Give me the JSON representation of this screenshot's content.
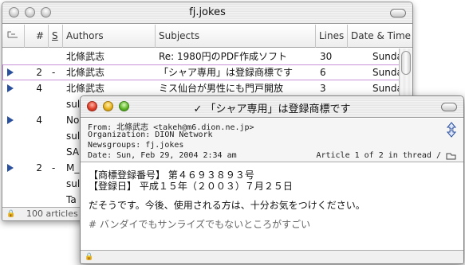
{
  "back_window": {
    "title": "fj.jokes",
    "columns": [
      "#",
      "S",
      "Authors",
      "Subjects",
      "Lines",
      "Date & Time"
    ],
    "rows": [
      {
        "num": "",
        "status": "",
        "author": "北條武志",
        "subject": "Re: 1980円のPDF作成ソフト",
        "lines": "30",
        "date": "Sunda",
        "triangle": false
      },
      {
        "num": "2",
        "status": "-",
        "author": "北條武志",
        "subject": "「シャア専用」は登録商標です",
        "lines": "6",
        "date": "Sunda",
        "triangle": true
      },
      {
        "num": "4",
        "status": "",
        "author": "北條武志",
        "subject": "ミス仙台が男性にも門戸開放",
        "lines": "3",
        "date": "Sunda",
        "triangle": true
      },
      {
        "num": "",
        "status": "",
        "author": "sul",
        "subject": "",
        "lines": "",
        "date": "",
        "triangle": false
      },
      {
        "num": "4",
        "status": "",
        "author": "No",
        "subject": "",
        "lines": "",
        "date": "",
        "triangle": true
      },
      {
        "num": "",
        "status": "",
        "author": "sul",
        "subject": "",
        "lines": "",
        "date": "",
        "triangle": false
      },
      {
        "num": "",
        "status": "",
        "author": "SA",
        "subject": "",
        "lines": "",
        "date": "",
        "triangle": false
      },
      {
        "num": "2",
        "status": "-",
        "author": "M_",
        "subject": "",
        "lines": "",
        "date": "",
        "triangle": true
      },
      {
        "num": "",
        "status": "",
        "author": "sul",
        "subject": "",
        "lines": "",
        "date": "",
        "triangle": false
      },
      {
        "num": "",
        "status": "",
        "author": "Ta",
        "subject": "",
        "lines": "",
        "date": "",
        "triangle": false
      }
    ],
    "status_text": "100 articles"
  },
  "front_window": {
    "title": "✓ 「シャア専用」は登録商標です",
    "from": "From: 北條武志 <takeh@m6.dion.ne.jp>",
    "organization": "Organization: DION Network",
    "newsgroups": "Newsgroups: fj.jokes",
    "date": "Date: Sun, Feb 29, 2004 2:34 am",
    "thread_info": "Article 1 of 2 in thread /",
    "body": [
      "【商標登録番号】 第４６９３８９３号",
      "【登録日】 平成１５年（２００３）７月２５日",
      "",
      "だそうです。今後、使用される方は、十分お気をつけください。",
      "",
      "# バンダイでもサンライズでもないところがすごい"
    ]
  }
}
